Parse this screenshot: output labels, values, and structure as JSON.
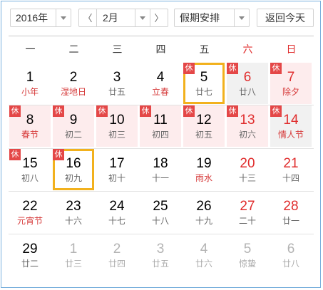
{
  "toolbar": {
    "year": "2016年",
    "month": "2月",
    "prev_symbol": "〈",
    "next_symbol": "〉",
    "holiday": "假期安排",
    "today_button": "返回今天"
  },
  "weekdays": [
    "一",
    "二",
    "三",
    "四",
    "五",
    "六",
    "日"
  ],
  "holiday_badge": "休",
  "colors": {
    "accent_red": "#e02d2d",
    "holiday_bg": "#fdeced",
    "selected_border": "#f2b11d",
    "frame": "#7ab0dd"
  },
  "weeks": [
    [
      {
        "day": "1",
        "lunar": "小年",
        "lunar_red": true
      },
      {
        "day": "2",
        "lunar": "湿地日",
        "lunar_red": true
      },
      {
        "day": "3",
        "lunar": "廿五"
      },
      {
        "day": "4",
        "lunar": "立春",
        "lunar_red": true
      },
      {
        "day": "5",
        "lunar": "廿七",
        "holiday": true,
        "selected": true
      },
      {
        "day": "6",
        "lunar": "廿八",
        "holiday": true,
        "weekend": true,
        "gray_bg": true
      },
      {
        "day": "7",
        "lunar": "除夕",
        "holiday": true,
        "weekend": true,
        "lunar_red": true,
        "pink": true
      }
    ],
    [
      {
        "day": "8",
        "lunar": "春节",
        "holiday": true,
        "pink": true,
        "lunar_red": true
      },
      {
        "day": "9",
        "lunar": "初二",
        "holiday": true,
        "pink": true
      },
      {
        "day": "10",
        "lunar": "初三",
        "holiday": true,
        "pink": true
      },
      {
        "day": "11",
        "lunar": "初四",
        "holiday": true,
        "pink": true
      },
      {
        "day": "12",
        "lunar": "初五",
        "holiday": true,
        "pink": true
      },
      {
        "day": "13",
        "lunar": "初六",
        "holiday": true,
        "weekend": true,
        "pink": true
      },
      {
        "day": "14",
        "lunar": "情人节",
        "holiday": true,
        "weekend": true,
        "lunar_red": true,
        "gray_bg": true
      }
    ],
    [
      {
        "day": "15",
        "lunar": "初八",
        "holiday": true
      },
      {
        "day": "16",
        "lunar": "初九",
        "holiday": true,
        "selected": true
      },
      {
        "day": "17",
        "lunar": "初十"
      },
      {
        "day": "18",
        "lunar": "十一"
      },
      {
        "day": "19",
        "lunar": "雨水",
        "lunar_red": true
      },
      {
        "day": "20",
        "lunar": "十三",
        "weekend": true
      },
      {
        "day": "21",
        "lunar": "十四",
        "weekend": true
      }
    ],
    [
      {
        "day": "22",
        "lunar": "元宵节",
        "lunar_red": true
      },
      {
        "day": "23",
        "lunar": "十六"
      },
      {
        "day": "24",
        "lunar": "十七"
      },
      {
        "day": "25",
        "lunar": "十八"
      },
      {
        "day": "26",
        "lunar": "十九"
      },
      {
        "day": "27",
        "lunar": "二十",
        "weekend": true
      },
      {
        "day": "28",
        "lunar": "廿一",
        "weekend": true
      }
    ],
    [
      {
        "day": "29",
        "lunar": "廿二"
      },
      {
        "day": "1",
        "lunar": "廿三",
        "other_month": true
      },
      {
        "day": "2",
        "lunar": "廿四",
        "other_month": true
      },
      {
        "day": "3",
        "lunar": "廿五",
        "other_month": true
      },
      {
        "day": "4",
        "lunar": "廿六",
        "other_month": true
      },
      {
        "day": "5",
        "lunar": "惊蛰",
        "other_month": true
      },
      {
        "day": "6",
        "lunar": "廿八",
        "other_month": true
      }
    ]
  ]
}
